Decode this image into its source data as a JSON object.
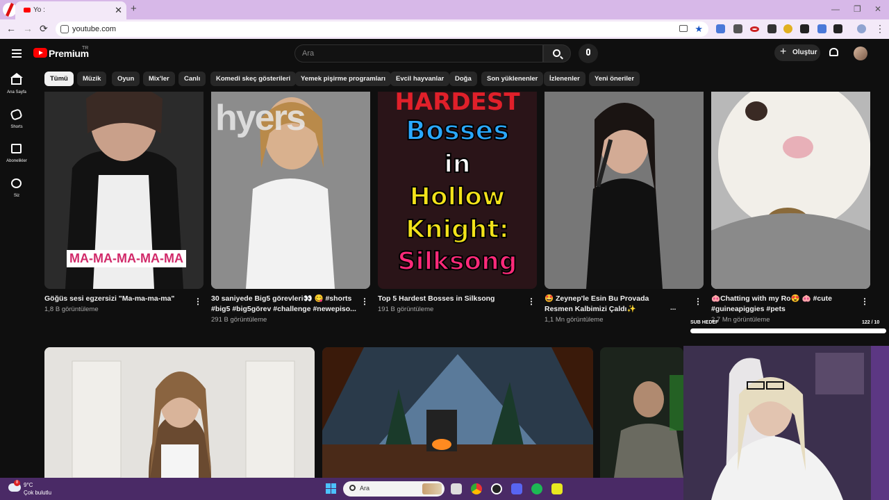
{
  "browser": {
    "tab_title": "Yo  :",
    "url": "youtube.com",
    "new_tab": "+",
    "close_tab": "✕",
    "min": "—",
    "restore": "❐",
    "close_window": "✕",
    "back": "←",
    "forward": "→",
    "reload": "⟳",
    "star": "★",
    "menu": "⋮"
  },
  "youtube": {
    "brand": "Premium",
    "country": "TR",
    "search_placeholder": "Ara",
    "create_label": "Oluştur",
    "create_plus": "+",
    "sidebar": [
      {
        "label": "Ana Sayfa",
        "icon": "home-icon"
      },
      {
        "label": "Shorts",
        "icon": "shorts-icon"
      },
      {
        "label": "Abonelikler",
        "icon": "subscriptions-icon"
      },
      {
        "label": "Siz",
        "icon": "you-icon"
      }
    ],
    "chips": [
      "Tümü",
      "Müzik",
      "Oyun",
      "Mix'ler",
      "Canlı",
      "Komedi skeç gösterileri",
      "Yemek pişirme programları",
      "Evcil hayvanlar",
      "Doğa",
      "Son yüklenenler",
      "İzlenenler",
      "Yeni öneriler"
    ],
    "videos": [
      {
        "title": "Göğüs sesi egzersizi \"Ma-ma-ma-ma\"",
        "views": "1,8 B görüntüleme",
        "thumb_text": "MA-MA-MA-MA-MA"
      },
      {
        "title": "30 saniyede Big5 görevleri👀 😋 #shorts #big5 #big5görev #challenge #newepiso...",
        "views": "291 B görüntüleme",
        "thumb_text": "hyers"
      },
      {
        "title": "Top 5 Hardest Bosses in Silksong",
        "views": "191 B görüntüleme",
        "thumb_lines": [
          "HARDEST",
          "Bosses",
          "in",
          "Hollow",
          "Knight:",
          "Silksong"
        ]
      },
      {
        "title": "🤩 Zeynep'le Esin Bu Provada Resmen Kalbimizi Çaldı✨",
        "views": "1,1 Mn görüntüleme"
      },
      {
        "title": "🐽Chatting with my Ro😍 🐽 #cute #guineapiggies #pets",
        "views": "2,7 Mn görüntüleme"
      }
    ],
    "more": "⋮",
    "ellipsis": "..."
  },
  "overlay": {
    "sub_goal_label": "SUB HEDEF",
    "sub_goal_count": "122 / 10"
  },
  "taskbar": {
    "weather_temp": "9°C",
    "weather_desc": "Çok bulutlu",
    "weather_badge": "8",
    "search_placeholder": "Ara"
  }
}
